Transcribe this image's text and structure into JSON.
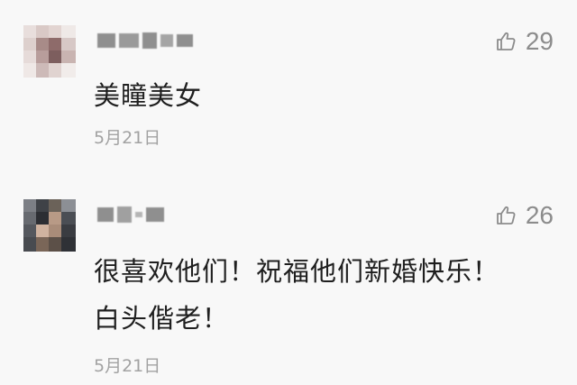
{
  "comments": [
    {
      "username": "",
      "likes": "29",
      "text_lines": [
        "美瞳美女"
      ],
      "date": "5月21日"
    },
    {
      "username": "",
      "likes": "26",
      "text_lines": [
        "很喜欢他们！祝福他们新婚快乐！",
        "白头偕老！"
      ],
      "date": "5月21日"
    }
  ],
  "icons": {
    "like": "thumbs-up-icon"
  },
  "colors": {
    "background": "#f8f8f8",
    "text": "#1f1f1f",
    "meta": "#a2a2a2",
    "like": "#8c8c8c"
  }
}
